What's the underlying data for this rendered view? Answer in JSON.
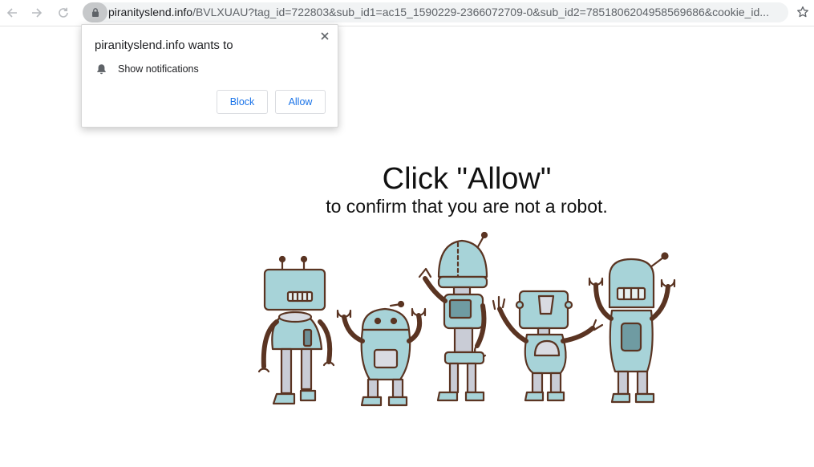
{
  "browser": {
    "url_host": "piranityslend.info",
    "url_path": "/BVLXUAU?tag_id=722803&sub_id1=ac15_1590229-2366072709-0&sub_id2=7851806204958569686&cookie_id...",
    "icons": {
      "back": "arrow-left-icon",
      "forward": "arrow-right-icon",
      "reload": "reload-icon",
      "secure": "lock-icon",
      "bookmark": "star-icon"
    }
  },
  "popup": {
    "title": "piranityslend.info wants to",
    "permission_icon": "bell-icon",
    "permission_label": "Show notifications",
    "block_label": "Block",
    "allow_label": "Allow",
    "close_icon": "close-icon"
  },
  "page": {
    "headline": "Click \"Allow\"",
    "subline": "to confirm that you are not a robot."
  },
  "colors": {
    "robot_fill": "#a7d3d8",
    "robot_outline": "#5a3422",
    "link_blue": "#1a73e8",
    "omnibox_bg": "#f1f3f4"
  }
}
